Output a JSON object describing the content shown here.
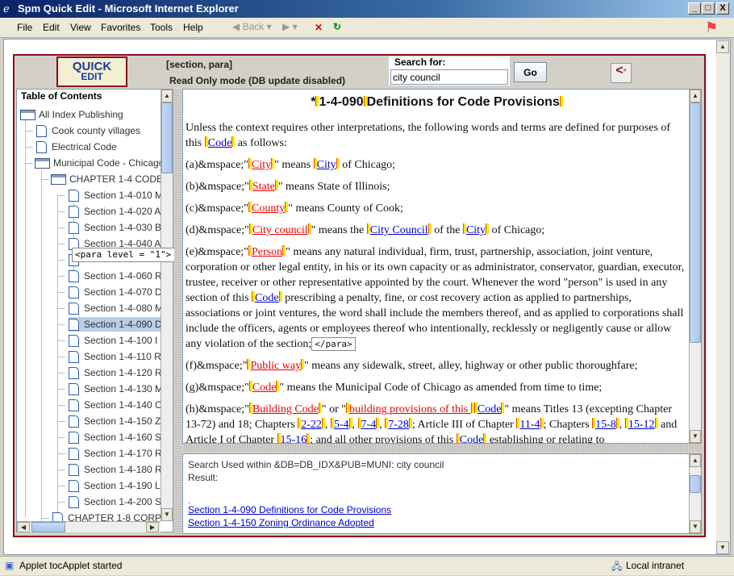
{
  "window": {
    "title": "Spm Quick Edit - Microsoft Internet Explorer",
    "controls": [
      "_",
      "□",
      "X"
    ]
  },
  "menu": [
    "File",
    "Edit",
    "View",
    "Favorites",
    "Tools",
    "Help"
  ],
  "toolbar": {
    "back": "Back"
  },
  "header": {
    "logo_line1": "QUICK",
    "logo_line2": "EDIT",
    "context": "[section, para]",
    "mode": "Read Only mode (DB update disabled)",
    "search_label": "Search for:",
    "search_value": "city council",
    "go": "Go"
  },
  "toc": {
    "title": "Table of Contents",
    "tooltip": "<para level = \"1\">",
    "items": [
      {
        "label": "All Index Publishing",
        "type": "folder",
        "level": 0
      },
      {
        "label": "Cook county villages",
        "type": "file",
        "level": 1
      },
      {
        "label": "Electrical Code",
        "type": "file",
        "level": 1
      },
      {
        "label": "Municipal Code - Chicago",
        "type": "folder",
        "level": 1
      },
      {
        "label": "CHAPTER 1-4 CODE",
        "type": "folder",
        "level": 2
      },
      {
        "label": "Section 1-4-010 M",
        "type": "file",
        "level": 3
      },
      {
        "label": "Section 1-4-020 A",
        "type": "file",
        "level": 3
      },
      {
        "label": "Section 1-4-030 B",
        "type": "file",
        "level": 3
      },
      {
        "label": "Section 1-4-040 A",
        "type": "file",
        "level": 3
      },
      {
        "label": "",
        "type": "file",
        "level": 3
      },
      {
        "label": "Section 1-4-060 R",
        "type": "file",
        "level": 3
      },
      {
        "label": "Section 1-4-070 D",
        "type": "file",
        "level": 3
      },
      {
        "label": "Section 1-4-080 M",
        "type": "file",
        "level": 3
      },
      {
        "label": "Section 1-4-090 D",
        "type": "file",
        "level": 3,
        "selected": true
      },
      {
        "label": "Section 1-4-100 I",
        "type": "file",
        "level": 3
      },
      {
        "label": "Section 1-4-110 R",
        "type": "file",
        "level": 3
      },
      {
        "label": "Section 1-4-120 R",
        "type": "file",
        "level": 3
      },
      {
        "label": "Section 1-4-130 M",
        "type": "file",
        "level": 3
      },
      {
        "label": "Section 1-4-140 C",
        "type": "file",
        "level": 3
      },
      {
        "label": "Section 1-4-150 Z",
        "type": "file",
        "level": 3
      },
      {
        "label": "Section 1-4-160 S",
        "type": "file",
        "level": 3
      },
      {
        "label": "Section 1-4-170 R",
        "type": "file",
        "level": 3
      },
      {
        "label": "Section 1-4-180 R",
        "type": "file",
        "level": 3
      },
      {
        "label": "Section 1-4-190 L",
        "type": "file",
        "level": 3
      },
      {
        "label": "Section 1-4-200 S",
        "type": "file",
        "level": 3
      },
      {
        "label": "CHAPTER 1-8 CORP",
        "type": "file",
        "level": 2
      }
    ]
  },
  "document": {
    "title_prefix": "*",
    "title_num": "1-4-090",
    "title_text": "Definitions for Code Provisions",
    "end_para": "</para>",
    "paragraphs": [
      [
        {
          "t": "Unless the context requires other interpretations, the following words and terms are defined for purposes of this "
        },
        {
          "t": "Code",
          "c": "blue"
        },
        {
          "t": " as follows:"
        }
      ],
      [
        {
          "t": "(a)&mspace;\""
        },
        {
          "t": "City",
          "c": "red"
        },
        {
          "t": "\" means "
        },
        {
          "t": "City",
          "c": "blue"
        },
        {
          "t": " of Chicago;"
        }
      ],
      [
        {
          "t": "(b)&mspace;\""
        },
        {
          "t": "State",
          "c": "red"
        },
        {
          "t": "\" means State of Illinois;"
        }
      ],
      [
        {
          "t": "(c)&mspace;\""
        },
        {
          "t": "County",
          "c": "red"
        },
        {
          "t": "\" means County of Cook;"
        }
      ],
      [
        {
          "t": "(d)&mspace;\""
        },
        {
          "t": "City council",
          "c": "red"
        },
        {
          "t": "\" means the "
        },
        {
          "t": "City Council",
          "c": "blue"
        },
        {
          "t": " of the "
        },
        {
          "t": "City",
          "c": "blue"
        },
        {
          "t": " of Chicago;"
        }
      ],
      [
        {
          "t": "(e)&mspace;\""
        },
        {
          "t": "Person",
          "c": "red"
        },
        {
          "t": "\" means any natural individual, firm, trust, partnership, association, joint venture, corporation or other legal entity, in his or its own capacity or as administrator, conservator, guardian, executor, trustee, receiver or other representative appointed by the court. Whenever the word \"person\" is used in any section of this "
        },
        {
          "t": "Code",
          "c": "blue"
        },
        {
          "t": " prescribing a penalty, fine, or cost recovery action as applied to partnerships, associations or joint ventures, the word shall include the members thereof, and as applied to corporations shall include the officers, agents or employees thereof who intentionally, recklessly or negligently cause or allow any violation of the section;"
        },
        {
          "end": true
        }
      ],
      [
        {
          "t": "(f)&mspace;\""
        },
        {
          "t": "Public way",
          "c": "red"
        },
        {
          "t": "\" means any sidewalk, street, alley, highway or other public thoroughfare;"
        }
      ],
      [
        {
          "t": "(g)&mspace;\""
        },
        {
          "t": "Code",
          "c": "red"
        },
        {
          "t": "\" means the Municipal Code of Chicago as amended from time to time;"
        }
      ],
      [
        {
          "t": "(h)&mspace;\""
        },
        {
          "t": "Building Code",
          "c": "red"
        },
        {
          "t": "\" or \""
        },
        {
          "t": "building provisions of this ",
          "c": "red"
        },
        {
          "t": "Code",
          "c": "blue"
        },
        {
          "t": "\" means Titles 13 (excepting Chapter 13-72) and 18; Chapters "
        },
        {
          "t": "2-22",
          "c": "blue"
        },
        {
          "t": ", "
        },
        {
          "t": "5-4",
          "c": "blue"
        },
        {
          "t": ", "
        },
        {
          "t": "7-4",
          "c": "blue"
        },
        {
          "t": ", "
        },
        {
          "t": "7-28",
          "c": "blue"
        },
        {
          "t": "; Article III of Chapter "
        },
        {
          "t": "11-4",
          "c": "blue"
        },
        {
          "t": "; Chapters "
        },
        {
          "t": "15-8",
          "c": "blue"
        },
        {
          "t": ", "
        },
        {
          "t": "15-12",
          "c": "blue"
        },
        {
          "t": " and Article I of Chapter "
        },
        {
          "t": "15-16",
          "c": "blue"
        },
        {
          "t": "; and all other provisions of this "
        },
        {
          "t": "Code",
          "c": "blue"
        },
        {
          "t": " establishing or relating to"
        }
      ]
    ]
  },
  "results": {
    "line1": "Search Used within &DB=DB_IDX&PUB=MUNI: city council",
    "line2": "Result:",
    "dot": ".",
    "links": [
      "Section 1-4-090 Definitions for Code Provisions",
      "Section 1-4-150 Zoning Ordinance Adopted"
    ]
  },
  "statusbar": {
    "text": "Applet tocApplet started",
    "zone": "Local intranet"
  },
  "colors": {
    "applet_border": "#8b0a1e",
    "defined_term": "#e00000",
    "reference_link": "#0000cc",
    "marker": "#ffe600"
  }
}
